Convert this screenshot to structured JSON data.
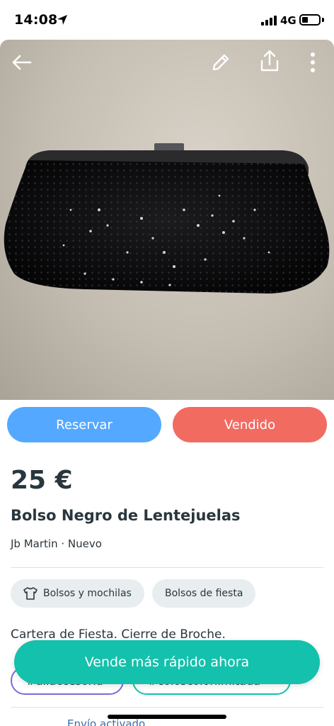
{
  "status_bar": {
    "time": "14:08",
    "network": "4G"
  },
  "listing": {
    "price": "25 €",
    "title": "Bolso Negro de Lentejuelas",
    "brand": "Jb Martin",
    "separator": "·",
    "condition": "Nuevo",
    "categories": [
      "Bolsos y mochilas",
      "Bolsos de fiesta"
    ],
    "description": "Cartera de Fiesta. Cierre de Broche.",
    "hashtags": [
      "#ullaccesoria",
      "#coloscolorlimitada"
    ],
    "shipping": "Envío activado"
  },
  "actions": {
    "reserve_label": "Reservar",
    "sold_label": "Vendido"
  },
  "cta": {
    "label": "Vende más rápido ahora"
  },
  "colors": {
    "reserve": "#54a8ff",
    "sold": "#f26b61",
    "cta": "#13c1ac",
    "text": "#29363d"
  },
  "icons": [
    "back-arrow-icon",
    "edit-pencil-icon",
    "share-icon",
    "more-options-icon",
    "location-arrow-icon",
    "signal-icon",
    "battery-icon",
    "shirt-icon"
  ]
}
